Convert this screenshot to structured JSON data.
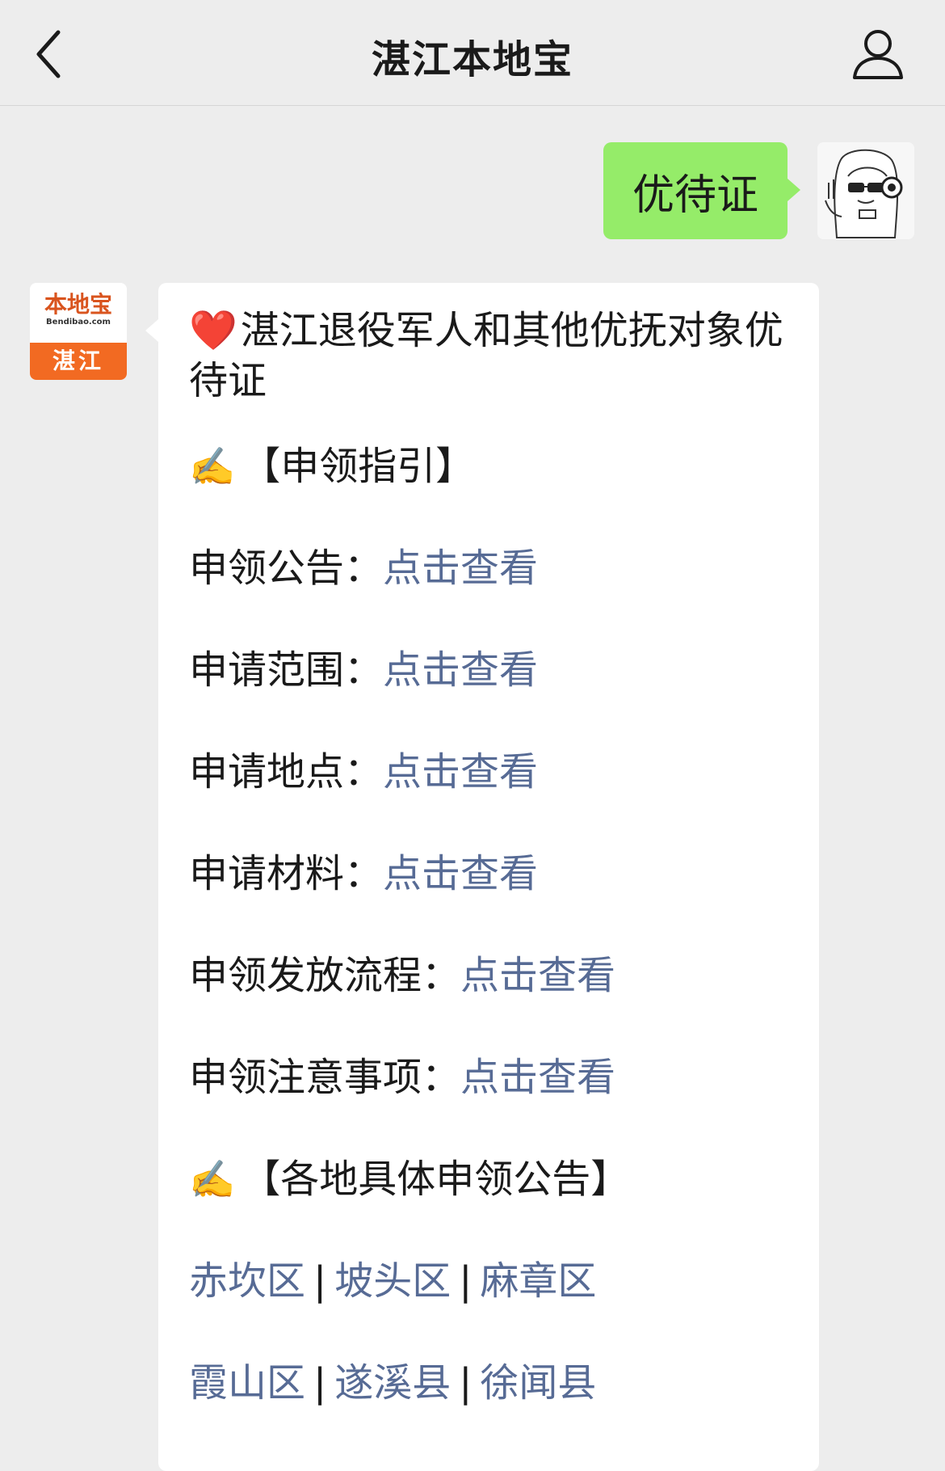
{
  "header": {
    "title": "湛江本地宝"
  },
  "user_message": {
    "text": "优待证"
  },
  "bot_avatar": {
    "logo_main": "本地宝",
    "logo_sub": "Bendibao.com",
    "logo_city": "湛江"
  },
  "bot_message": {
    "heart": "❤️",
    "title": "湛江退役军人和其他优抚对象优待证",
    "section1": {
      "pen": "✍️",
      "label": "【申领指引】"
    },
    "rows": [
      {
        "label": "申领公告：",
        "link": "点击查看"
      },
      {
        "label": "申请范围：",
        "link": "点击查看"
      },
      {
        "label": "申请地点：",
        "link": "点击查看"
      },
      {
        "label": "申请材料：",
        "link": "点击查看"
      },
      {
        "label": "申领发放流程：",
        "link": "点击查看"
      },
      {
        "label": "申领注意事项：",
        "link": "点击查看"
      }
    ],
    "section2": {
      "pen": "✍️",
      "label": "【各地具体申领公告】"
    },
    "districts_row1": [
      "赤坎区",
      "坡头区",
      "麻章区"
    ],
    "districts_row2": [
      "霞山区",
      "遂溪县",
      "徐闻县"
    ],
    "separator": "|"
  },
  "colors": {
    "background": "#ededed",
    "user_bubble": "#95ec69",
    "link": "#576b95",
    "logo_orange": "#f26a22"
  }
}
